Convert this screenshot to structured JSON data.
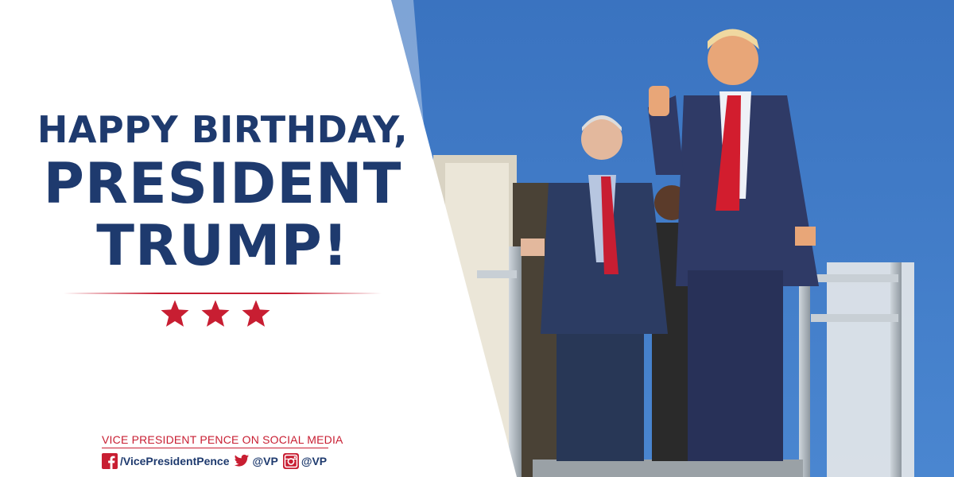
{
  "headline": {
    "line1": "HAPPY BIRTHDAY,",
    "line2": "PRESIDENT",
    "line3": "TRUMP!"
  },
  "decoration": {
    "star_count": 3,
    "star_color": "#c81e32"
  },
  "social": {
    "title": "VICE PRESIDENT PENCE ON SOCIAL MEDIA",
    "facebook_handle": "/VicePresidentPence",
    "twitter_handle": "@VP",
    "instagram_handle": "@VP",
    "icons": [
      "facebook-icon",
      "twitter-icon",
      "instagram-icon"
    ]
  },
  "colors": {
    "navy": "#1e3a6e",
    "red": "#c81e32",
    "sky": "#3f78c4"
  }
}
